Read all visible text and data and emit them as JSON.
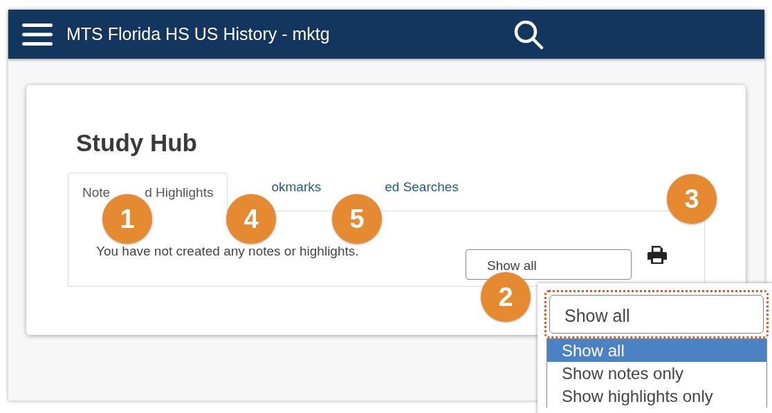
{
  "header": {
    "title": "MTS Florida HS US History - mktg"
  },
  "page": {
    "title": "Study Hub"
  },
  "tabs": [
    {
      "parts": [
        "Note",
        "d Highlights"
      ],
      "selected": true
    },
    {
      "parts": [
        "okmarks"
      ],
      "selected": false
    },
    {
      "parts": [
        "ed Searches"
      ],
      "selected": false
    }
  ],
  "panel": {
    "message": "You have not created any notes or highlights.",
    "filter": {
      "value": "Show all"
    }
  },
  "dropdown": {
    "value": "Show all",
    "focused": true,
    "options": [
      {
        "label": "Show all",
        "selected": true
      },
      {
        "label": "Show notes only",
        "selected": false
      },
      {
        "label": "Show highlights only",
        "selected": false
      }
    ]
  },
  "callouts": [
    {
      "number": "1"
    },
    {
      "number": "4"
    },
    {
      "number": "5"
    },
    {
      "number": "3"
    },
    {
      "number": "2"
    }
  ]
}
